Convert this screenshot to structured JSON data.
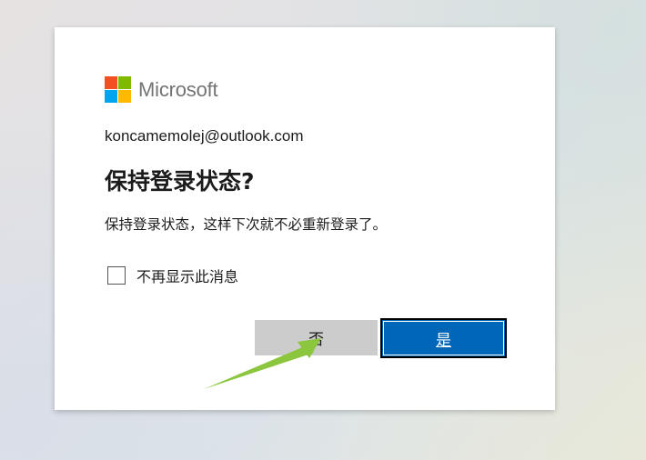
{
  "brand": {
    "name": "Microsoft",
    "logo_colors": [
      "#f25022",
      "#7fba00",
      "#00a4ef",
      "#ffb900"
    ]
  },
  "account": {
    "email": "koncamemolej@outlook.com"
  },
  "dialog": {
    "title": "保持登录状态?",
    "description": "保持登录状态，这样下次就不必重新登录了。",
    "checkbox_label": "不再显示此消息",
    "checkbox_checked": false,
    "no_label": "否",
    "yes_label": "是"
  },
  "colors": {
    "primary_button": "#0067b8",
    "secondary_button": "#cccccc",
    "annotation_arrow": "#8cc63f"
  }
}
